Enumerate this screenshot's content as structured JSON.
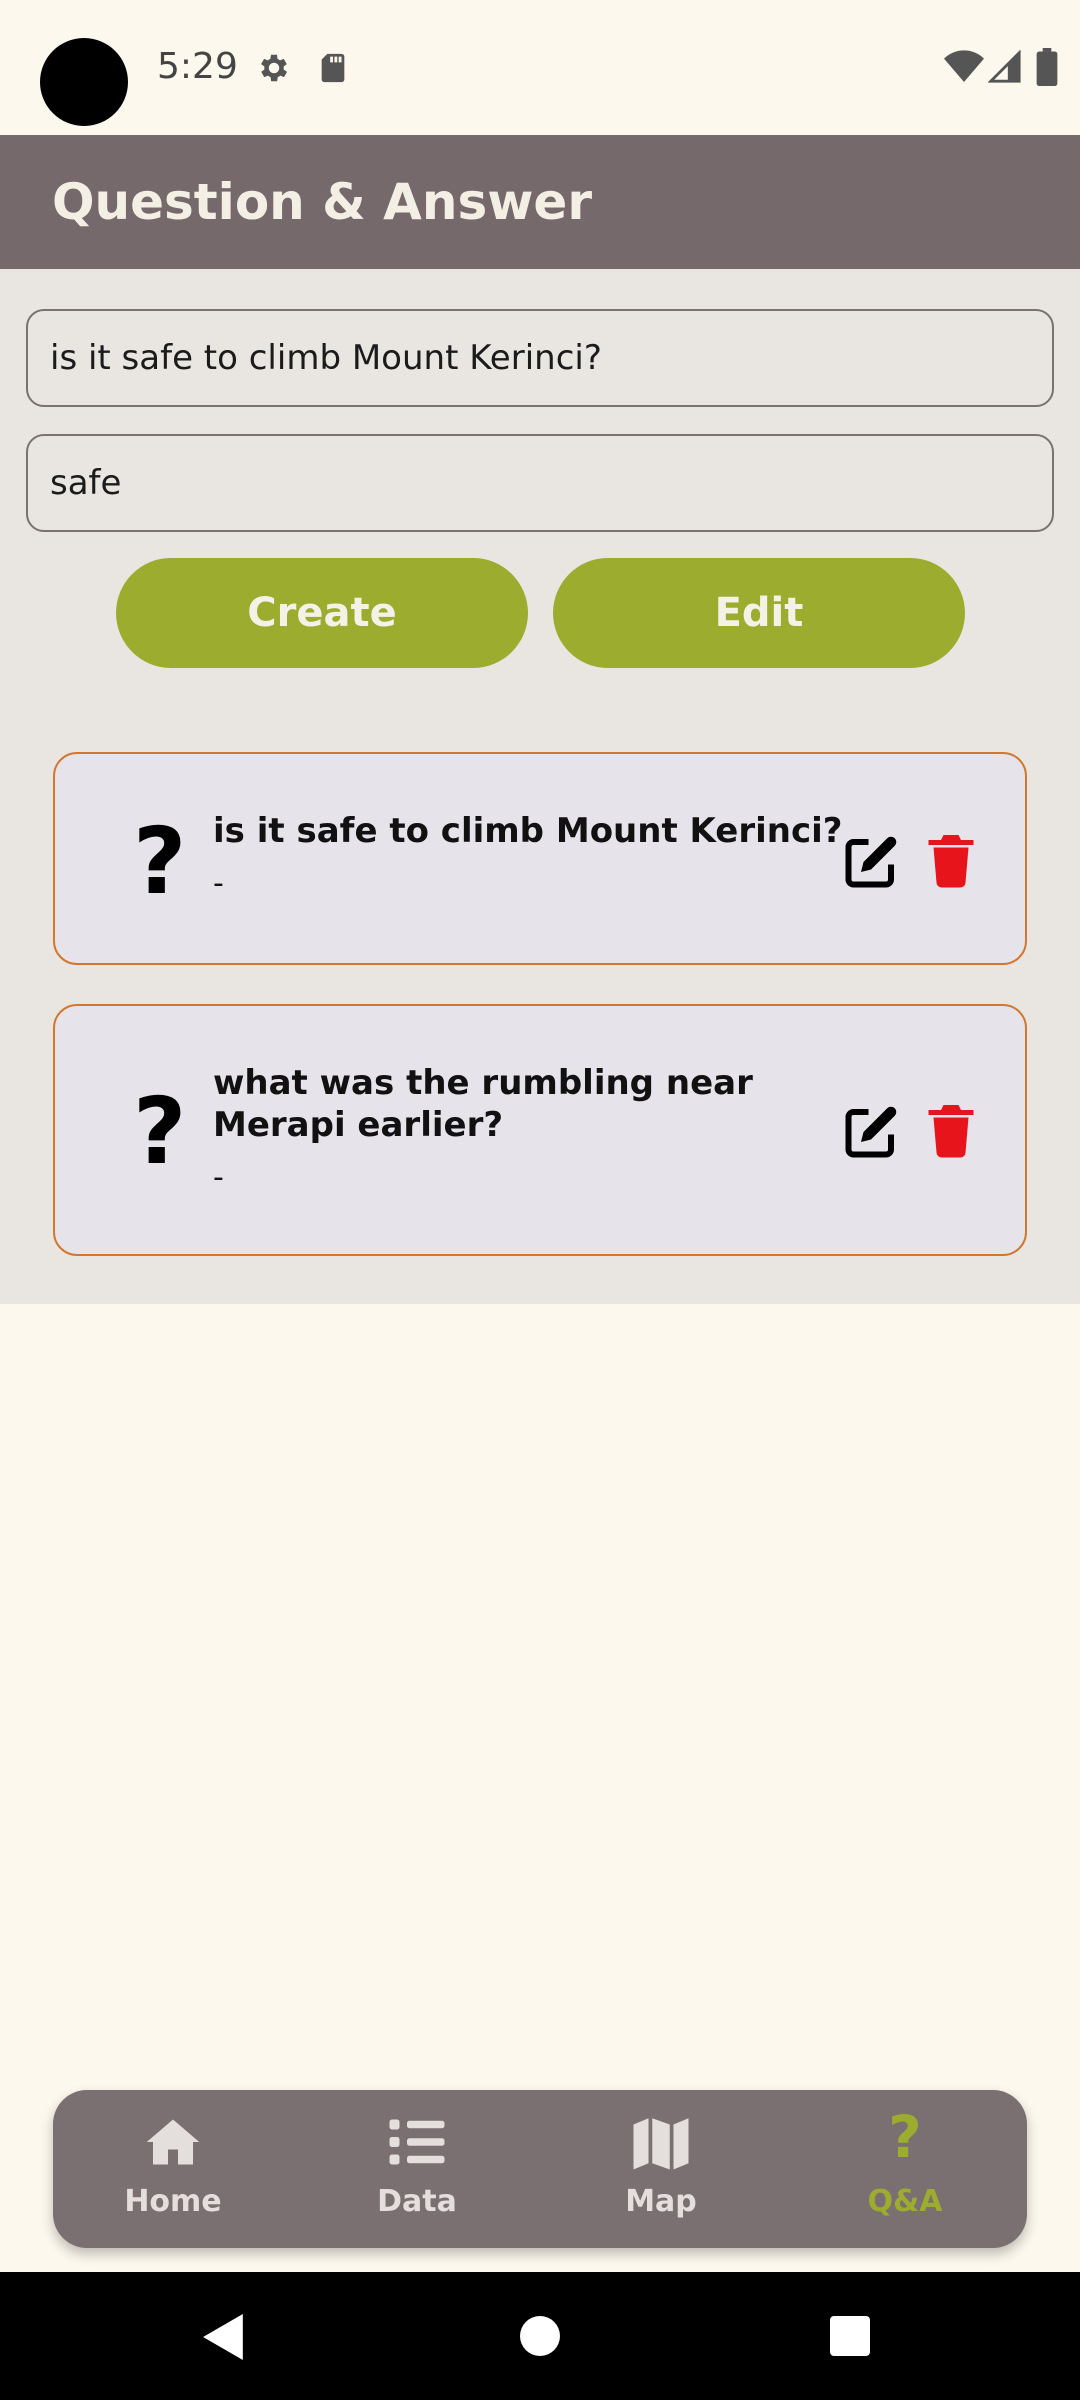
{
  "status_bar": {
    "time": "5:29",
    "icons": [
      "settings-icon",
      "sd-card-icon",
      "wifi-icon",
      "cell-signal-icon",
      "battery-icon"
    ]
  },
  "app_bar": {
    "title": "Question & Answer"
  },
  "form": {
    "question_value": "is it safe to climb Mount Kerinci?",
    "answer_value": "safe",
    "create_label": "Create",
    "edit_label": "Edit"
  },
  "qa_list": [
    {
      "question": "is it safe to climb Mount Kerinci?",
      "answer": "-"
    },
    {
      "question": "what was the rumbling near Merapi earlier?",
      "answer": "-"
    }
  ],
  "bottom_nav": {
    "items": [
      {
        "label": "Home",
        "icon": "home-icon",
        "active": false
      },
      {
        "label": "Data",
        "icon": "list-icon",
        "active": false
      },
      {
        "label": "Map",
        "icon": "map-icon",
        "active": false
      },
      {
        "label": "Q&A",
        "icon": "question-icon",
        "active": true
      }
    ]
  },
  "colors": {
    "app_bar": "#76696C",
    "accent": "#9BAC2F",
    "card_border": "#D2782E",
    "delete": "#E8141B",
    "background": "#FCF8EE"
  }
}
